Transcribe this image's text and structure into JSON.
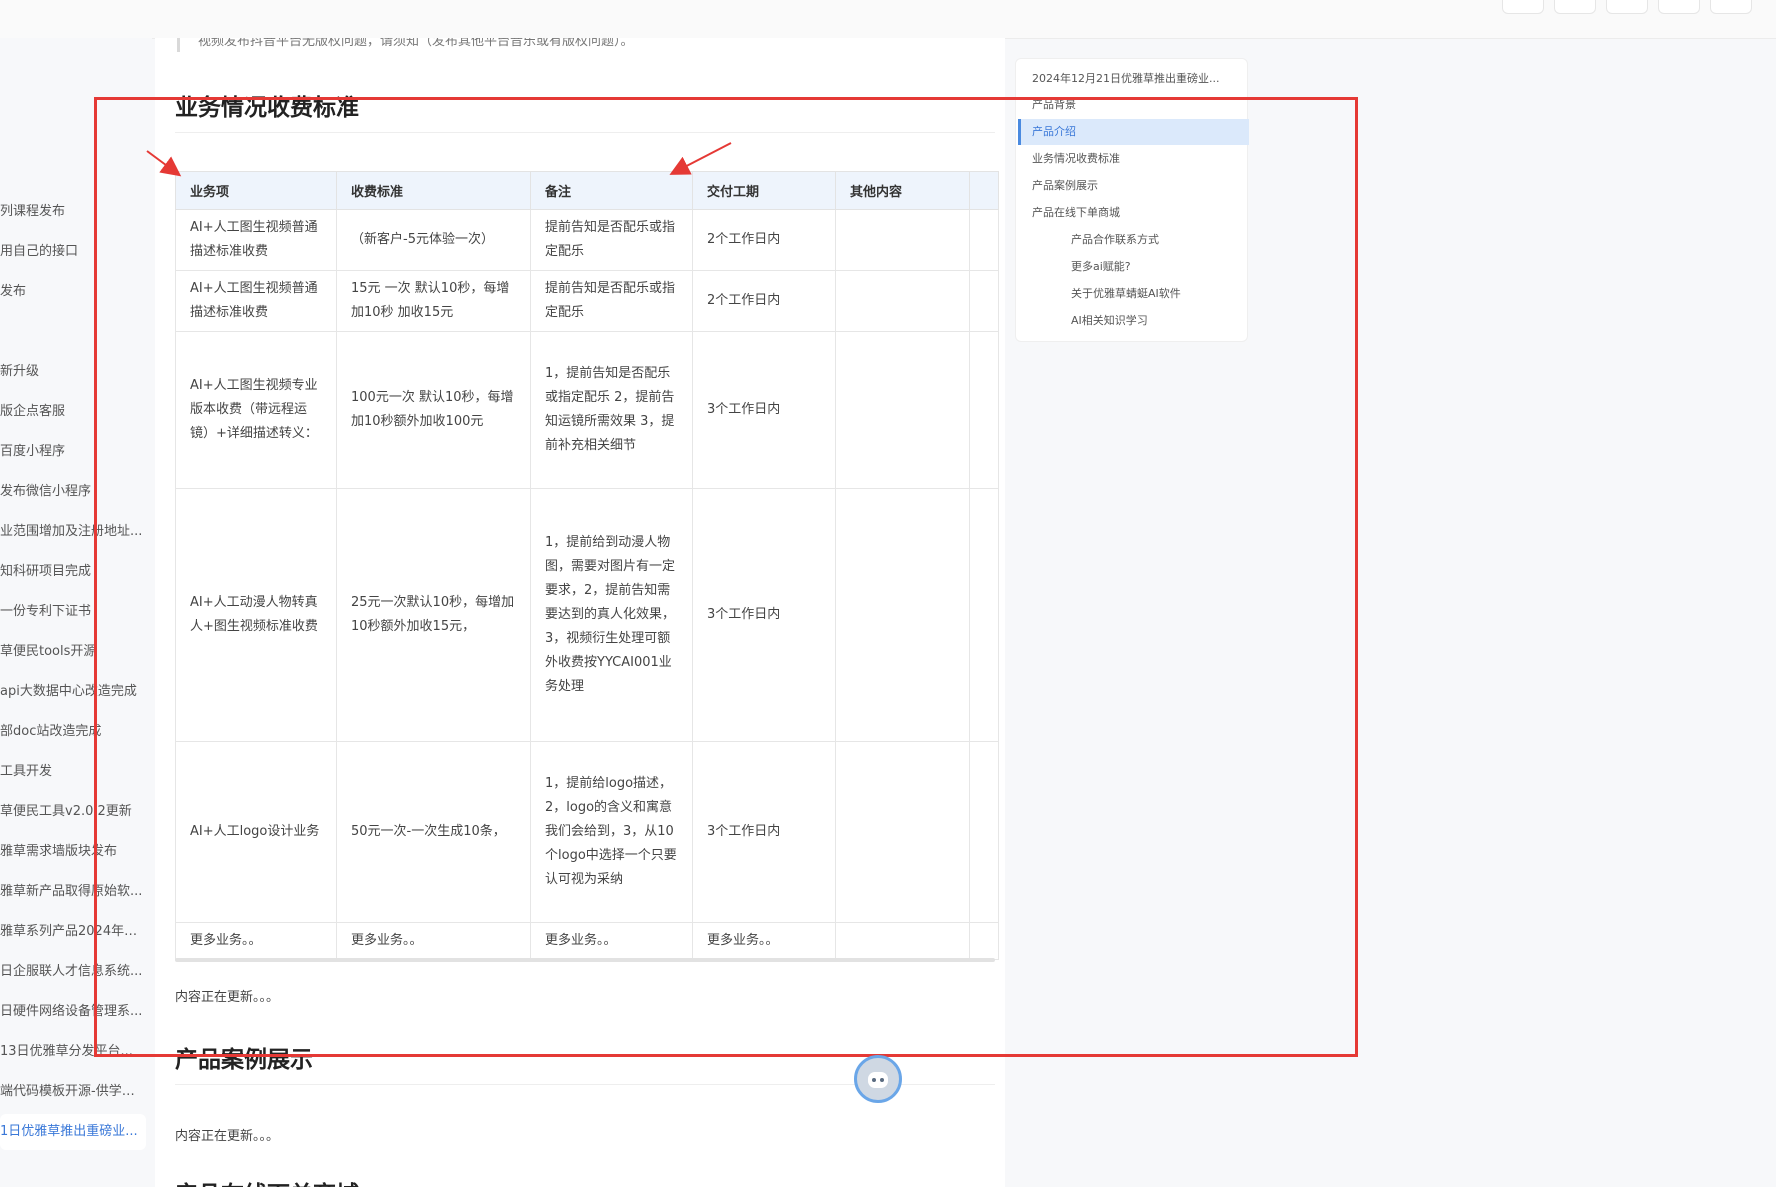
{
  "quote_text": "视频发布抖音平台无版权问题，请须知（发布其他平台音乐或有版权问题）。",
  "sidebar": {
    "items": [
      {
        "label": "列课程发布"
      },
      {
        "label": "用自己的接口"
      },
      {
        "label": "发布"
      },
      {
        "label": "新升级"
      },
      {
        "label": "版企点客服"
      },
      {
        "label": "百度小程序"
      },
      {
        "label": "发布微信小程序"
      },
      {
        "label": "业范围增加及注册地址..."
      },
      {
        "label": "知科研项目完成"
      },
      {
        "label": "一份专利下证书"
      },
      {
        "label": "草便民tools开源"
      },
      {
        "label": "api大数据中心改造完成"
      },
      {
        "label": "部doc站改造完成"
      },
      {
        "label": "工具开发"
      },
      {
        "label": "草便民工具v2.0.2更新"
      },
      {
        "label": "雅草需求墙版块发布"
      },
      {
        "label": "雅草新产品取得原始软..."
      },
      {
        "label": "雅草系列产品2024年全..."
      },
      {
        "label": "日企服联人才信息系统..."
      },
      {
        "label": "日硬件网络设备管理系..."
      },
      {
        "label": "13日优雅草分发平台..."
      },
      {
        "label": "端代码模板开源-供学习..."
      },
      {
        "label": "1日优雅草推出重磅业..."
      }
    ]
  },
  "main": {
    "section1_title": "业务情况收费标准",
    "table": {
      "headers": [
        "业务项",
        "收费标准",
        "备注",
        "交付工期",
        "其他内容"
      ],
      "rows": [
        {
          "c1": "AI+人工图生视频普通描述标准收费",
          "c2": "（新客户-5元体验一次）",
          "c3": "提前告知是否配乐或指定配乐",
          "c4": "2个工作日内",
          "c5": ""
        },
        {
          "c1": "AI+人工图生视频普通描述标准收费",
          "c2": "15元 一次 默认10秒，每增加10秒 加收15元",
          "c3": "提前告知是否配乐或指定配乐",
          "c4": "2个工作日内",
          "c5": ""
        },
        {
          "c1": "AI+人工图生视频专业版本收费（带远程运镜）+详细描述转义：",
          "c2": "100元一次 默认10秒，每增加10秒额外加收100元",
          "c3": "1，提前告知是否配乐或指定配乐 2，提前告知运镜所需效果 3，提前补充相关细节",
          "c4": "3个工作日内",
          "c5": ""
        },
        {
          "c1": "AI+人工动漫人物转真人+图生视频标准收费",
          "c2": "25元一次默认10秒，每增加10秒额外加收15元，",
          "c3": "1，提前给到动漫人物图，需要对图片有一定要求，2，提前告知需要达到的真人化效果，3，视频衍生处理可额外收费按YYCAI001业务处理",
          "c4": "3个工作日内",
          "c5": ""
        },
        {
          "c1": "AI+人工logo设计业务",
          "c2": "50元一次-一次生成10条，",
          "c3": "1，提前给logo描述，2，logo的含义和寓意我们会给到，3，从10个logo中选择一个只要认可视为采纳",
          "c4": "3个工作日内",
          "c5": ""
        },
        {
          "c1": "更多业务。。",
          "c2": "更多业务。。",
          "c3": "更多业务。。",
          "c4": "更多业务。。",
          "c5": ""
        }
      ]
    },
    "updating_text_1": "内容正在更新。。。",
    "section2_title": "产品案例展示",
    "updating_text_2": "内容正在更新。。。",
    "section3_title": "产品在线下单商城"
  },
  "toc": {
    "items": [
      {
        "label": "2024年12月21日优雅草推出重磅业..."
      },
      {
        "label": "产品背景"
      },
      {
        "label": "产品介绍"
      },
      {
        "label": "业务情况收费标准"
      },
      {
        "label": "产品案例展示"
      },
      {
        "label": "产品在线下单商城"
      },
      {
        "label": "产品合作联系方式"
      },
      {
        "label": "更多ai赋能?"
      },
      {
        "label": "关于优雅草蜻蜓AI软件"
      },
      {
        "label": "AI相关知识学习"
      }
    ]
  },
  "colors": {
    "annotation_red": "#e53935",
    "link_blue": "#3a78d8",
    "table_header_bg": "#eef4fc",
    "toc_active_bg": "#dbe9fb"
  }
}
